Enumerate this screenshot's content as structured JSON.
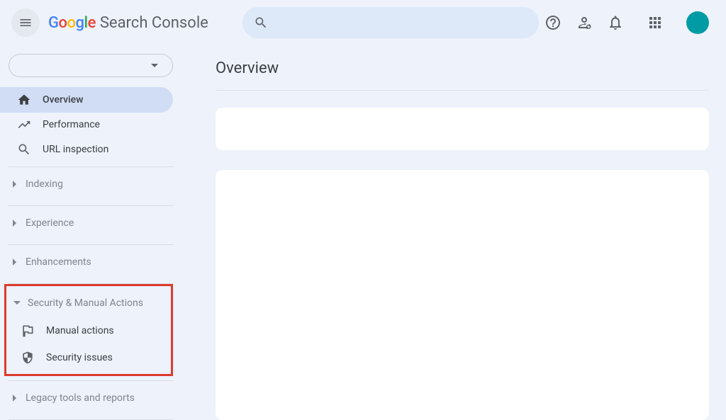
{
  "header": {
    "product": "Search Console",
    "logo_letters": [
      "G",
      "o",
      "o",
      "g",
      "l",
      "e"
    ]
  },
  "sidebar": {
    "items": [
      {
        "icon": "home",
        "label": "Overview",
        "active": true
      },
      {
        "icon": "trending",
        "label": "Performance",
        "active": false
      },
      {
        "icon": "search",
        "label": "URL inspection",
        "active": false
      }
    ],
    "groups": [
      {
        "label": "Indexing",
        "expanded": false
      },
      {
        "label": "Experience",
        "expanded": false
      },
      {
        "label": "Enhancements",
        "expanded": false
      }
    ],
    "security": {
      "label": "Security & Manual Actions",
      "expanded": true,
      "items": [
        {
          "icon": "flag",
          "label": "Manual actions"
        },
        {
          "icon": "shield",
          "label": "Security issues"
        }
      ]
    },
    "legacy": {
      "label": "Legacy tools and reports",
      "expanded": false
    }
  },
  "main": {
    "title": "Overview"
  },
  "colors": {
    "accent": "#d0ddf4",
    "highlight": "#dc3b2d",
    "avatar": "#009ba5"
  }
}
